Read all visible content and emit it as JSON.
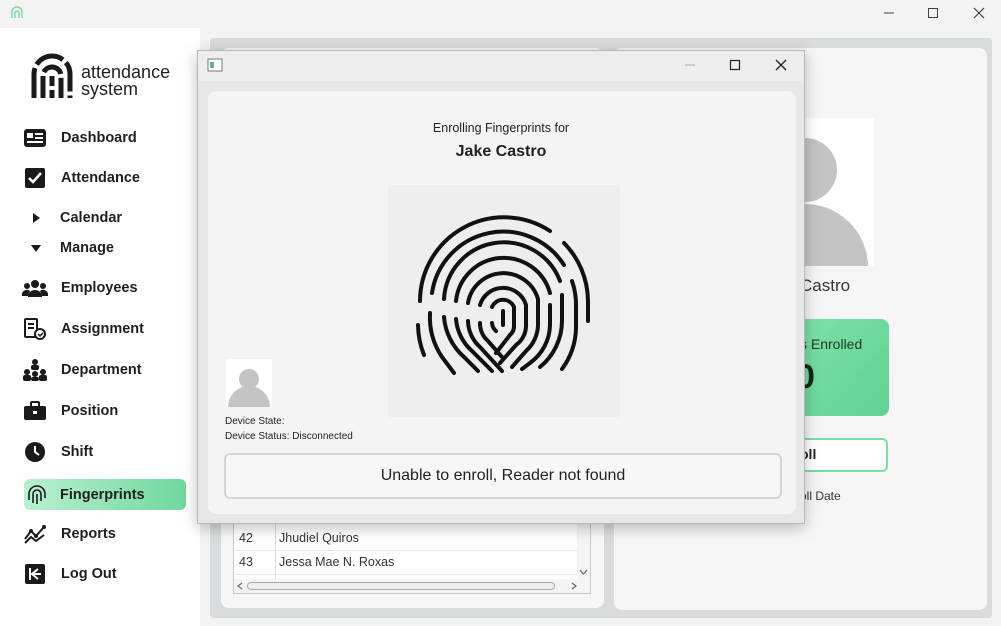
{
  "window": {
    "controls": [
      "minimize",
      "maximize",
      "close"
    ]
  },
  "brand": {
    "line1": "attendance",
    "line2": "system"
  },
  "sidebar": {
    "items": [
      {
        "label": "Dashboard",
        "icon": "dashboard-icon"
      },
      {
        "label": "Attendance",
        "icon": "checkbox-icon"
      },
      {
        "label": "Calendar",
        "icon": "caret-right-icon"
      },
      {
        "label": "Manage",
        "icon": "caret-down-icon"
      },
      {
        "label": "Employees",
        "icon": "users-icon"
      },
      {
        "label": "Assignment",
        "icon": "assignment-icon"
      },
      {
        "label": "Department",
        "icon": "department-icon"
      },
      {
        "label": "Position",
        "icon": "briefcase-icon"
      },
      {
        "label": "Shift",
        "icon": "clock-icon"
      },
      {
        "label": "Fingerprints",
        "icon": "fingerprint-icon",
        "active": true
      },
      {
        "label": "Reports",
        "icon": "chart-icon"
      },
      {
        "label": "Log Out",
        "icon": "logout-icon"
      }
    ]
  },
  "employee_list": {
    "rows": [
      {
        "id": "42",
        "name": "Jhudiel Quiros"
      },
      {
        "id": "43",
        "name": "Jessa Mae N. Roxas"
      }
    ]
  },
  "detail": {
    "name_fragment": "Castro",
    "enrolled_label_fragment": "s Enrolled",
    "enrolled_count_fragment": "0",
    "enroll_button_fragment": "oll",
    "enroll_date_fragment": "oll Date"
  },
  "dialog": {
    "heading": "Enrolling Fingerprints for",
    "name": "Jake Castro",
    "device_state_label": "Device State:",
    "device_status_label": "Device Status: Disconnected",
    "status_message": "Unable to enroll, Reader not found"
  },
  "colors": {
    "accent": "#6fd89e",
    "accent_light": "#b9f0cf",
    "card_green": "#5fd291"
  }
}
